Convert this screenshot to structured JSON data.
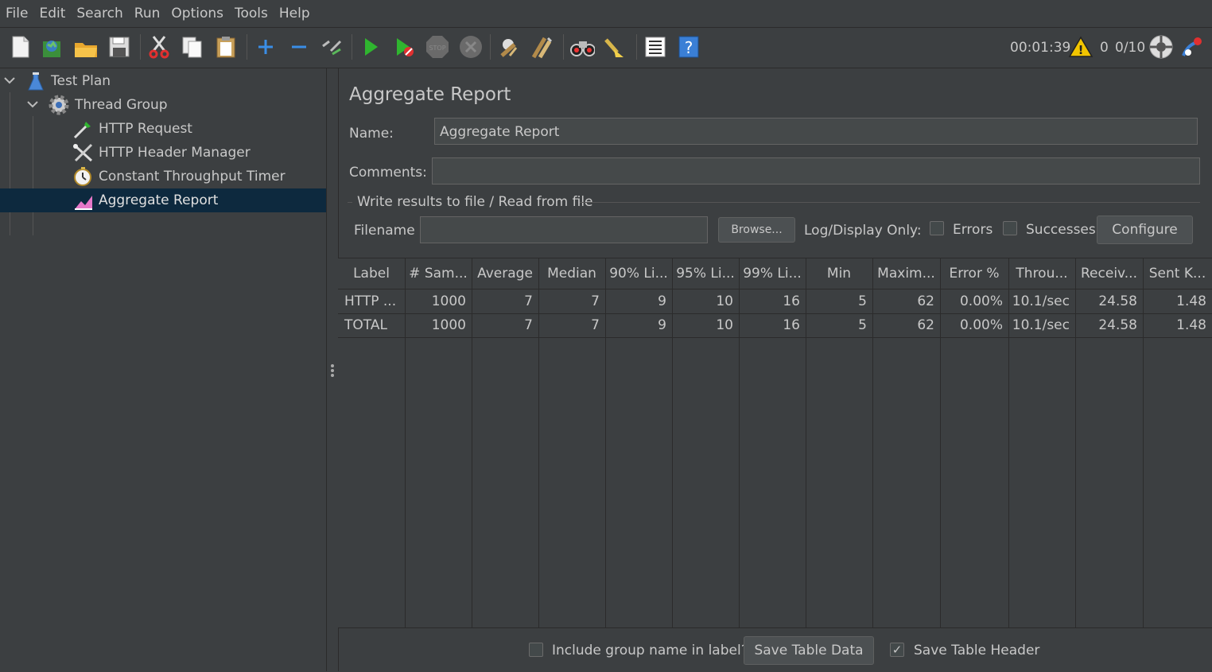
{
  "menu": [
    "File",
    "Edit",
    "Search",
    "Run",
    "Options",
    "Tools",
    "Help"
  ],
  "status": {
    "elapsed": "00:01:39",
    "warnings": "0",
    "threads": "0/10"
  },
  "tree": {
    "items": [
      {
        "label": "Test Plan"
      },
      {
        "label": "Thread Group"
      },
      {
        "label": "HTTP Request"
      },
      {
        "label": "HTTP Header Manager"
      },
      {
        "label": "Constant Throughput Timer"
      },
      {
        "label": "Aggregate Report"
      }
    ]
  },
  "panel": {
    "title": "Aggregate Report",
    "name_label": "Name:",
    "name_value": "Aggregate Report",
    "comments_label": "Comments:",
    "comments_value": "",
    "file_group_label": "Write results to file / Read from file",
    "filename_label": "Filename",
    "filename_value": "",
    "browse_label": "Browse...",
    "log_display_label": "Log/Display Only:",
    "errors_label": "Errors",
    "successes_label": "Successes",
    "configure_label": "Configure"
  },
  "table": {
    "headers": [
      "Label",
      "# Sam...",
      "Average",
      "Median",
      "90% Li...",
      "95% Li...",
      "99% Li...",
      "Min",
      "Maxim...",
      "Error %",
      "Throu...",
      "Receiv...",
      "Sent K..."
    ],
    "rows": [
      [
        "HTTP ...",
        "1000",
        "7",
        "7",
        "9",
        "10",
        "16",
        "5",
        "62",
        "0.00%",
        "10.1/sec",
        "24.58",
        "1.48"
      ],
      [
        "TOTAL",
        "1000",
        "7",
        "7",
        "9",
        "10",
        "16",
        "5",
        "62",
        "0.00%",
        "10.1/sec",
        "24.58",
        "1.48"
      ]
    ]
  },
  "bottom": {
    "include_group_label": "Include group name in label?",
    "include_group_checked": false,
    "save_table_data_label": "Save Table Data",
    "save_table_header_label": "Save Table Header",
    "save_table_header_checked": true
  }
}
